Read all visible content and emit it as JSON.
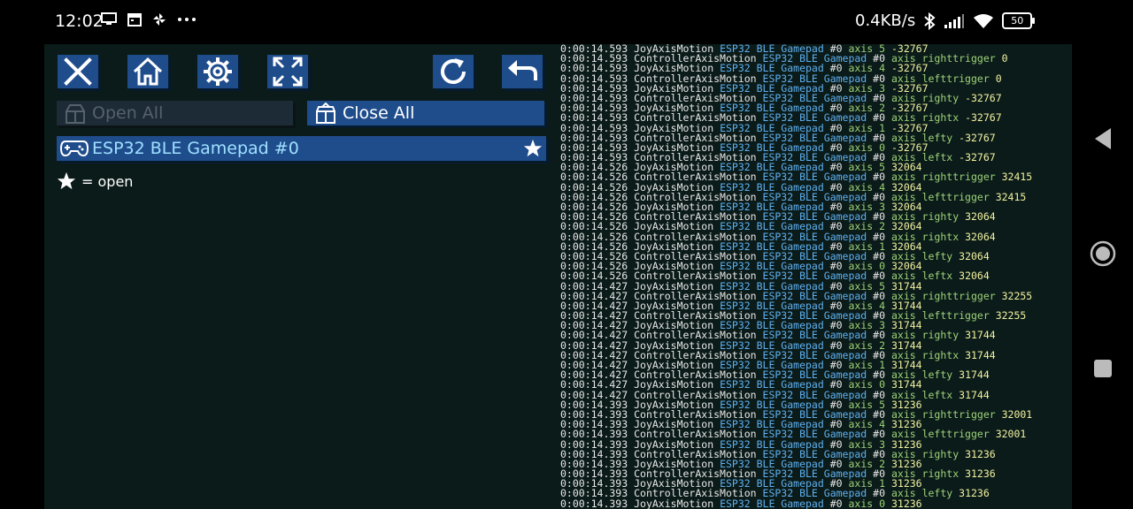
{
  "status_bar": {
    "time": "12:02",
    "speed": "0.4KB/s",
    "battery": "50",
    "colors": {
      "icon": "#ffffff"
    }
  },
  "toolbar": {
    "close_icon": "close-icon",
    "home_icon": "home-icon",
    "settings_icon": "gear-icon",
    "fullscreen_icon": "fullscreen-icon",
    "refresh_icon": "refresh-icon",
    "back_icon": "back-icon"
  },
  "actions": {
    "open_all": "Open All",
    "close_all": "Close All"
  },
  "device": {
    "name": "ESP32 BLE Gamepad #0"
  },
  "legend": {
    "text": "= open"
  },
  "colors": {
    "button": "#1f4d8c",
    "background": "#0b1b19",
    "device_text": "#9fe0ff"
  },
  "log": [
    {
      "t": "0:00:14.593",
      "e": "JoyAxisMotion",
      "d": "ESP32 BLE Gamepad",
      "id": "#0",
      "a": "axis 5",
      "v": "-32767"
    },
    {
      "t": "0:00:14.593",
      "e": "ControllerAxisMotion",
      "d": "ESP32 BLE Gamepad",
      "id": "#0",
      "a": "axis righttrigger",
      "v": "0"
    },
    {
      "t": "0:00:14.593",
      "e": "JoyAxisMotion",
      "d": "ESP32 BLE Gamepad",
      "id": "#0",
      "a": "axis 4",
      "v": "-32767"
    },
    {
      "t": "0:00:14.593",
      "e": "ControllerAxisMotion",
      "d": "ESP32 BLE Gamepad",
      "id": "#0",
      "a": "axis lefttrigger",
      "v": "0"
    },
    {
      "t": "0:00:14.593",
      "e": "JoyAxisMotion",
      "d": "ESP32 BLE Gamepad",
      "id": "#0",
      "a": "axis 3",
      "v": "-32767"
    },
    {
      "t": "0:00:14.593",
      "e": "ControllerAxisMotion",
      "d": "ESP32 BLE Gamepad",
      "id": "#0",
      "a": "axis righty",
      "v": "-32767"
    },
    {
      "t": "0:00:14.593",
      "e": "JoyAxisMotion",
      "d": "ESP32 BLE Gamepad",
      "id": "#0",
      "a": "axis 2",
      "v": "-32767"
    },
    {
      "t": "0:00:14.593",
      "e": "ControllerAxisMotion",
      "d": "ESP32 BLE Gamepad",
      "id": "#0",
      "a": "axis rightx",
      "v": "-32767"
    },
    {
      "t": "0:00:14.593",
      "e": "JoyAxisMotion",
      "d": "ESP32 BLE Gamepad",
      "id": "#0",
      "a": "axis 1",
      "v": "-32767"
    },
    {
      "t": "0:00:14.593",
      "e": "ControllerAxisMotion",
      "d": "ESP32 BLE Gamepad",
      "id": "#0",
      "a": "axis lefty",
      "v": "-32767"
    },
    {
      "t": "0:00:14.593",
      "e": "JoyAxisMotion",
      "d": "ESP32 BLE Gamepad",
      "id": "#0",
      "a": "axis 0",
      "v": "-32767"
    },
    {
      "t": "0:00:14.593",
      "e": "ControllerAxisMotion",
      "d": "ESP32 BLE Gamepad",
      "id": "#0",
      "a": "axis leftx",
      "v": "-32767"
    },
    {
      "t": "0:00:14.526",
      "e": "JoyAxisMotion",
      "d": "ESP32 BLE Gamepad",
      "id": "#0",
      "a": "axis 5",
      "v": "32064"
    },
    {
      "t": "0:00:14.526",
      "e": "ControllerAxisMotion",
      "d": "ESP32 BLE Gamepad",
      "id": "#0",
      "a": "axis righttrigger",
      "v": "32415"
    },
    {
      "t": "0:00:14.526",
      "e": "JoyAxisMotion",
      "d": "ESP32 BLE Gamepad",
      "id": "#0",
      "a": "axis 4",
      "v": "32064"
    },
    {
      "t": "0:00:14.526",
      "e": "ControllerAxisMotion",
      "d": "ESP32 BLE Gamepad",
      "id": "#0",
      "a": "axis lefttrigger",
      "v": "32415"
    },
    {
      "t": "0:00:14.526",
      "e": "JoyAxisMotion",
      "d": "ESP32 BLE Gamepad",
      "id": "#0",
      "a": "axis 3",
      "v": "32064"
    },
    {
      "t": "0:00:14.526",
      "e": "ControllerAxisMotion",
      "d": "ESP32 BLE Gamepad",
      "id": "#0",
      "a": "axis righty",
      "v": "32064"
    },
    {
      "t": "0:00:14.526",
      "e": "JoyAxisMotion",
      "d": "ESP32 BLE Gamepad",
      "id": "#0",
      "a": "axis 2",
      "v": "32064"
    },
    {
      "t": "0:00:14.526",
      "e": "ControllerAxisMotion",
      "d": "ESP32 BLE Gamepad",
      "id": "#0",
      "a": "axis rightx",
      "v": "32064"
    },
    {
      "t": "0:00:14.526",
      "e": "JoyAxisMotion",
      "d": "ESP32 BLE Gamepad",
      "id": "#0",
      "a": "axis 1",
      "v": "32064"
    },
    {
      "t": "0:00:14.526",
      "e": "ControllerAxisMotion",
      "d": "ESP32 BLE Gamepad",
      "id": "#0",
      "a": "axis lefty",
      "v": "32064"
    },
    {
      "t": "0:00:14.526",
      "e": "JoyAxisMotion",
      "d": "ESP32 BLE Gamepad",
      "id": "#0",
      "a": "axis 0",
      "v": "32064"
    },
    {
      "t": "0:00:14.526",
      "e": "ControllerAxisMotion",
      "d": "ESP32 BLE Gamepad",
      "id": "#0",
      "a": "axis leftx",
      "v": "32064"
    },
    {
      "t": "0:00:14.427",
      "e": "JoyAxisMotion",
      "d": "ESP32 BLE Gamepad",
      "id": "#0",
      "a": "axis 5",
      "v": "31744"
    },
    {
      "t": "0:00:14.427",
      "e": "ControllerAxisMotion",
      "d": "ESP32 BLE Gamepad",
      "id": "#0",
      "a": "axis righttrigger",
      "v": "32255"
    },
    {
      "t": "0:00:14.427",
      "e": "JoyAxisMotion",
      "d": "ESP32 BLE Gamepad",
      "id": "#0",
      "a": "axis 4",
      "v": "31744"
    },
    {
      "t": "0:00:14.427",
      "e": "ControllerAxisMotion",
      "d": "ESP32 BLE Gamepad",
      "id": "#0",
      "a": "axis lefttrigger",
      "v": "32255"
    },
    {
      "t": "0:00:14.427",
      "e": "JoyAxisMotion",
      "d": "ESP32 BLE Gamepad",
      "id": "#0",
      "a": "axis 3",
      "v": "31744"
    },
    {
      "t": "0:00:14.427",
      "e": "ControllerAxisMotion",
      "d": "ESP32 BLE Gamepad",
      "id": "#0",
      "a": "axis righty",
      "v": "31744"
    },
    {
      "t": "0:00:14.427",
      "e": "JoyAxisMotion",
      "d": "ESP32 BLE Gamepad",
      "id": "#0",
      "a": "axis 2",
      "v": "31744"
    },
    {
      "t": "0:00:14.427",
      "e": "ControllerAxisMotion",
      "d": "ESP32 BLE Gamepad",
      "id": "#0",
      "a": "axis rightx",
      "v": "31744"
    },
    {
      "t": "0:00:14.427",
      "e": "JoyAxisMotion",
      "d": "ESP32 BLE Gamepad",
      "id": "#0",
      "a": "axis 1",
      "v": "31744"
    },
    {
      "t": "0:00:14.427",
      "e": "ControllerAxisMotion",
      "d": "ESP32 BLE Gamepad",
      "id": "#0",
      "a": "axis lefty",
      "v": "31744"
    },
    {
      "t": "0:00:14.427",
      "e": "JoyAxisMotion",
      "d": "ESP32 BLE Gamepad",
      "id": "#0",
      "a": "axis 0",
      "v": "31744"
    },
    {
      "t": "0:00:14.427",
      "e": "ControllerAxisMotion",
      "d": "ESP32 BLE Gamepad",
      "id": "#0",
      "a": "axis leftx",
      "v": "31744"
    },
    {
      "t": "0:00:14.393",
      "e": "JoyAxisMotion",
      "d": "ESP32 BLE Gamepad",
      "id": "#0",
      "a": "axis 5",
      "v": "31236"
    },
    {
      "t": "0:00:14.393",
      "e": "ControllerAxisMotion",
      "d": "ESP32 BLE Gamepad",
      "id": "#0",
      "a": "axis righttrigger",
      "v": "32001"
    },
    {
      "t": "0:00:14.393",
      "e": "JoyAxisMotion",
      "d": "ESP32 BLE Gamepad",
      "id": "#0",
      "a": "axis 4",
      "v": "31236"
    },
    {
      "t": "0:00:14.393",
      "e": "ControllerAxisMotion",
      "d": "ESP32 BLE Gamepad",
      "id": "#0",
      "a": "axis lefttrigger",
      "v": "32001"
    },
    {
      "t": "0:00:14.393",
      "e": "JoyAxisMotion",
      "d": "ESP32 BLE Gamepad",
      "id": "#0",
      "a": "axis 3",
      "v": "31236"
    },
    {
      "t": "0:00:14.393",
      "e": "ControllerAxisMotion",
      "d": "ESP32 BLE Gamepad",
      "id": "#0",
      "a": "axis righty",
      "v": "31236"
    },
    {
      "t": "0:00:14.393",
      "e": "JoyAxisMotion",
      "d": "ESP32 BLE Gamepad",
      "id": "#0",
      "a": "axis 2",
      "v": "31236"
    },
    {
      "t": "0:00:14.393",
      "e": "ControllerAxisMotion",
      "d": "ESP32 BLE Gamepad",
      "id": "#0",
      "a": "axis rightx",
      "v": "31236"
    },
    {
      "t": "0:00:14.393",
      "e": "JoyAxisMotion",
      "d": "ESP32 BLE Gamepad",
      "id": "#0",
      "a": "axis 1",
      "v": "31236"
    },
    {
      "t": "0:00:14.393",
      "e": "ControllerAxisMotion",
      "d": "ESP32 BLE Gamepad",
      "id": "#0",
      "a": "axis lefty",
      "v": "31236"
    },
    {
      "t": "0:00:14.393",
      "e": "JoyAxisMotion",
      "d": "ESP32 BLE Gamepad",
      "id": "#0",
      "a": "axis 0",
      "v": "31236"
    }
  ],
  "nav": {
    "back_icon": "nav-back-icon",
    "home_icon": "nav-home-icon",
    "recents_icon": "nav-recents-icon"
  }
}
